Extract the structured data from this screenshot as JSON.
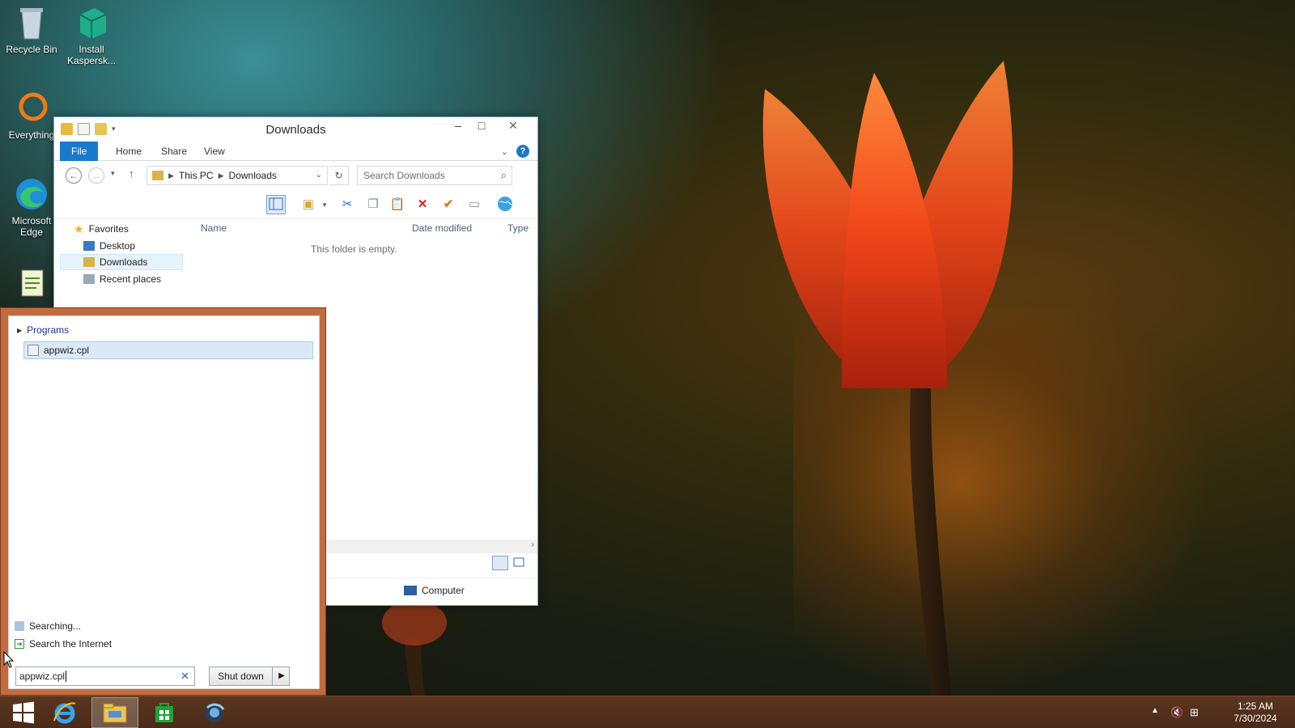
{
  "desktop": {
    "icons": [
      {
        "label": "Recycle Bin",
        "icon": "recycle-bin-icon"
      },
      {
        "label": "Install Kaspersk...",
        "icon": "kaspersky-installer-icon"
      },
      {
        "label": "Everything",
        "icon": "everything-search-icon"
      },
      {
        "label": "Microsoft Edge",
        "icon": "edge-icon"
      },
      {
        "label": "",
        "icon": "notepad-shortcut-icon"
      }
    ]
  },
  "explorer": {
    "title": "Downloads",
    "tabs": {
      "file": "File",
      "home": "Home",
      "share": "Share",
      "view": "View"
    },
    "address": {
      "root": "This PC",
      "folder": "Downloads"
    },
    "search_placeholder": "Search Downloads",
    "nav": {
      "favorites": "Favorites",
      "desktop": "Desktop",
      "downloads": "Downloads",
      "recent": "Recent places"
    },
    "columns": {
      "name": "Name",
      "date": "Date modified",
      "type": "Type"
    },
    "empty_text": "This folder is empty.",
    "status_location": "Computer"
  },
  "start_search": {
    "group": "Programs",
    "result": "appwiz.cpl",
    "searching": "Searching...",
    "search_internet": "Search the Internet",
    "query": "appwiz.cpl",
    "shutdown_label": "Shut down"
  },
  "taskbar": {
    "apps": [
      "start-icon",
      "internet-explorer-icon",
      "file-explorer-icon",
      "store-icon",
      "browser-icon"
    ],
    "time": "1:25 AM",
    "date": "7/30/2024"
  }
}
